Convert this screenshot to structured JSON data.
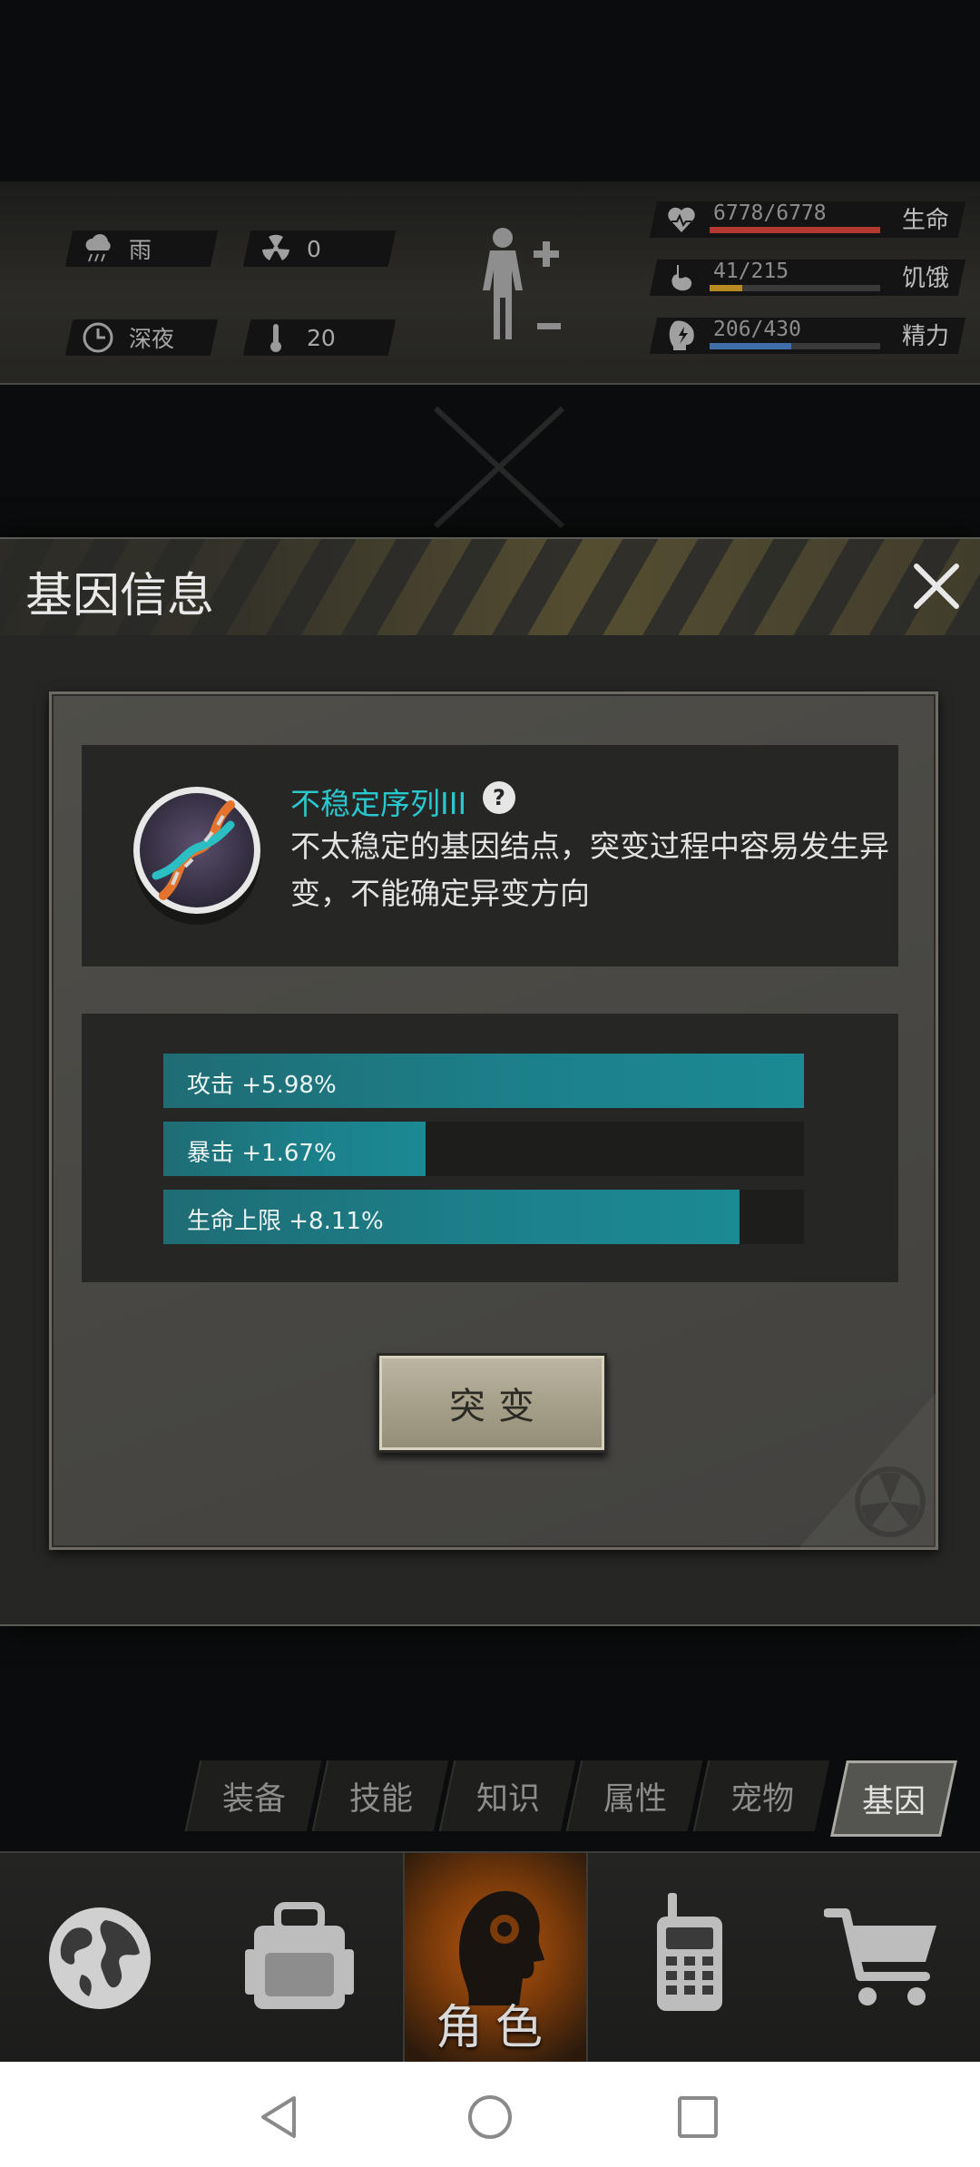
{
  "hud": {
    "weather": "雨",
    "radiation": "0",
    "time_of_day": "深夜",
    "temperature": "20",
    "stats": [
      {
        "label": "生命",
        "value": "6778/6778",
        "fill": 1.0,
        "color": "#b3382e",
        "icon": "heart-icon"
      },
      {
        "label": "饥饿",
        "value": "41/215",
        "fill": 0.19,
        "color": "#b88a22",
        "icon": "stomach-icon"
      },
      {
        "label": "精力",
        "value": "206/430",
        "fill": 0.48,
        "color": "#3f6ea8",
        "icon": "energy-icon"
      }
    ]
  },
  "dialog": {
    "title": "基因信息",
    "gene_name": "不稳定序列III",
    "gene_desc": "不太稳定的基因结点，突变过程中容易发生异变，不能确定异变方向",
    "attributes": [
      {
        "text": "攻击 +5.98%",
        "fill": 1.0
      },
      {
        "text": "暴击 +1.67%",
        "fill": 0.41
      },
      {
        "text": "生命上限 +8.11%",
        "fill": 0.9
      }
    ],
    "mutate_button": "突变"
  },
  "subtabs": [
    "装备",
    "技能",
    "知识",
    "属性",
    "宠物",
    "基因"
  ],
  "active_subtab": "基因",
  "nav": {
    "items": [
      "globe-icon",
      "backpack-icon",
      "character-icon",
      "radio-icon",
      "cart-icon"
    ],
    "active_label": "角色"
  },
  "accent": "#29c8cf"
}
